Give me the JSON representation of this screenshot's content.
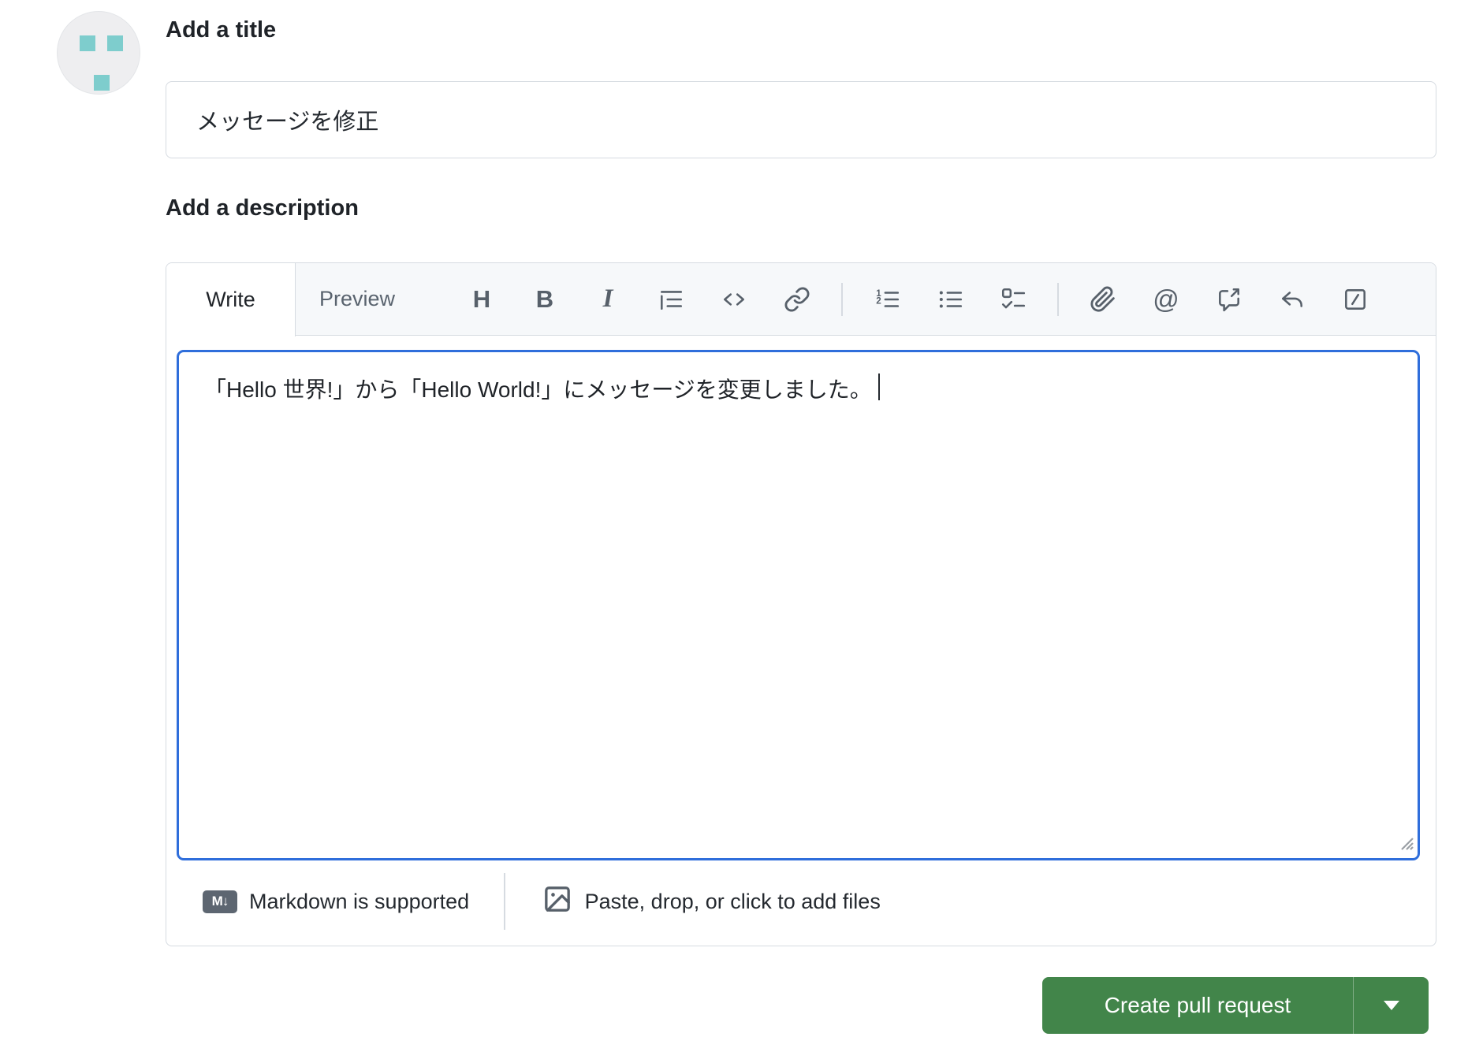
{
  "title_section": {
    "heading": "Add a title",
    "input_value": "メッセージを修正"
  },
  "description_section": {
    "heading": "Add a description",
    "tabs": {
      "write": "Write",
      "preview": "Preview"
    },
    "toolbar_glyphs": {
      "heading": "H",
      "bold": "B",
      "italic": "I",
      "mention": "@"
    },
    "toolbar_icons": [
      "heading",
      "bold",
      "italic",
      "quote",
      "code",
      "link",
      "numbered-list",
      "bullet-list",
      "task-list",
      "attach-file",
      "mention",
      "cross-reference",
      "reply",
      "slash-commands"
    ],
    "body_text": "「Hello 世界!」から「Hello World!」にメッセージを変更しました。",
    "footer": {
      "markdown_badge": "M↓",
      "markdown_note": "Markdown is supported",
      "attach_note": "Paste, drop, or click to add files"
    }
  },
  "actions": {
    "create_pull_request": "Create pull request"
  },
  "colors": {
    "button_green": "#42854a",
    "focus_blue": "#2f6edb",
    "avatar_teal": "#7ecdcd",
    "icon_gray": "#57606a",
    "border_gray": "#d6dbe1",
    "header_bg": "#f6f8fa"
  }
}
